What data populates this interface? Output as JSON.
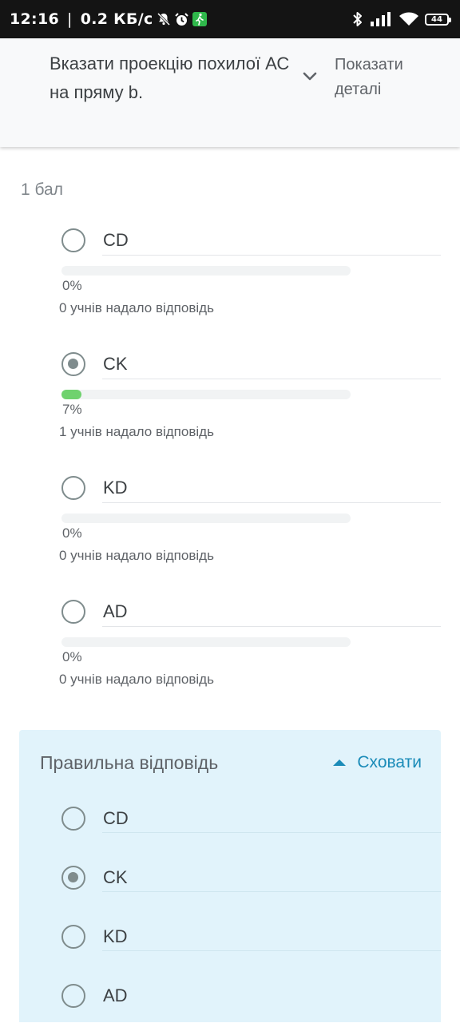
{
  "status_bar": {
    "time": "12:16",
    "separator": "|",
    "speed": "0.2 КБ/с",
    "battery": "44"
  },
  "question": {
    "title": "Вказати проекцію похилої АС на пряму b.",
    "details_label": "Показати деталі",
    "points": "1 бал"
  },
  "options": [
    {
      "label": "CD",
      "selected": false,
      "percent_text": "0%",
      "percent": 0,
      "responses": "0 учнів надало відповідь"
    },
    {
      "label": "CK",
      "selected": true,
      "percent_text": "7%",
      "percent": 7,
      "responses": "1 учнів надало відповідь"
    },
    {
      "label": "KD",
      "selected": false,
      "percent_text": "0%",
      "percent": 0,
      "responses": "0 учнів надало відповідь"
    },
    {
      "label": "AD",
      "selected": false,
      "percent_text": "0%",
      "percent": 0,
      "responses": "0 учнів надало відповідь"
    }
  ],
  "correct_answer": {
    "title": "Правильна відповідь",
    "hide_label": "Сховати",
    "options": [
      {
        "label": "CD",
        "selected": false
      },
      {
        "label": "CK",
        "selected": true
      },
      {
        "label": "KD",
        "selected": false
      },
      {
        "label": "AD",
        "selected": false
      }
    ]
  },
  "colors": {
    "progress_fill": "#6fd26e",
    "accent": "#1a8bb8",
    "answer_panel_bg": "#e1f3fb"
  }
}
